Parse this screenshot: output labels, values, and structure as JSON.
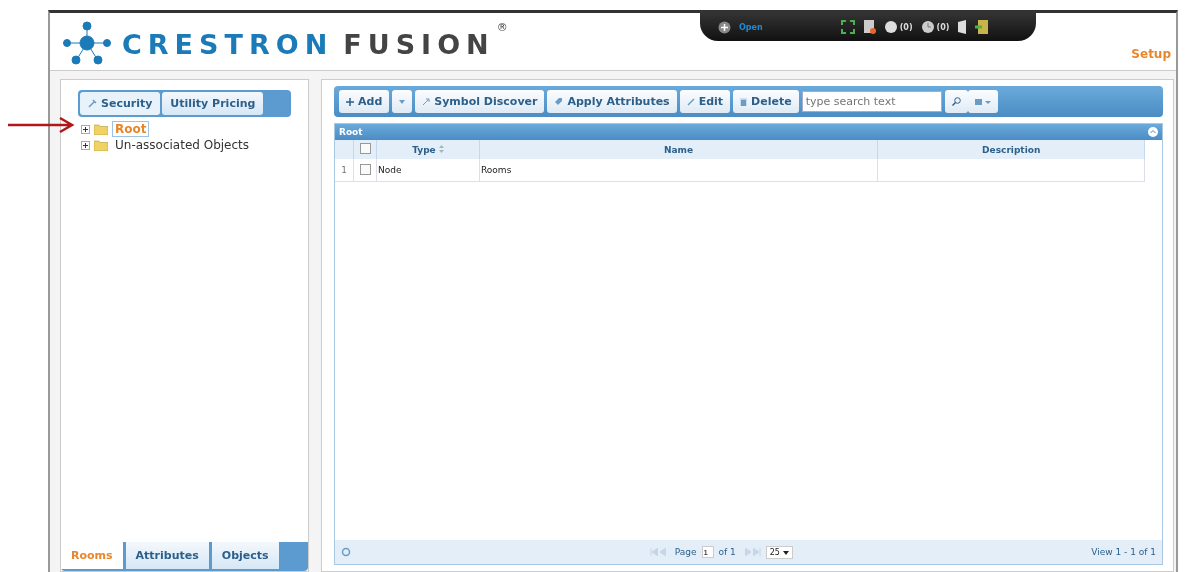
{
  "logo": {
    "brand": "CRESTRON",
    "product": "FUSION",
    "mark": "®"
  },
  "topbar": {
    "open_label": "Open",
    "counters": [
      "(0)",
      "(0)"
    ]
  },
  "setup_link": "Setup",
  "left_tabs": [
    {
      "label": "Security",
      "selected": true
    },
    {
      "label": "Utility Pricing",
      "selected": false
    }
  ],
  "tree": [
    {
      "label": "Root",
      "selected": true,
      "expanded": false
    },
    {
      "label": "Un-associated Objects",
      "selected": false,
      "expanded": false
    }
  ],
  "bottom_tabs": [
    {
      "label": "Rooms",
      "selected": true
    },
    {
      "label": "Attributes",
      "selected": false
    },
    {
      "label": "Objects",
      "selected": false
    }
  ],
  "toolbar": {
    "buttons": [
      {
        "kind": "add",
        "label": "Add"
      },
      {
        "kind": "caret"
      },
      {
        "kind": "discover",
        "label": "Symbol Discover"
      },
      {
        "kind": "apply",
        "label": "Apply Attributes"
      },
      {
        "kind": "edit",
        "label": "Edit"
      },
      {
        "kind": "delete",
        "label": "Delete"
      }
    ],
    "search_placeholder": "type search text"
  },
  "grid": {
    "caption": "Root",
    "all_checked": false,
    "columns": [
      "Type",
      "Name",
      "Description"
    ],
    "rows": [
      {
        "number": "1",
        "checked": false,
        "cells": [
          "Node",
          "Rooms",
          ""
        ]
      }
    ],
    "pager": {
      "page_label": "Page",
      "page": "1",
      "of": "of 1",
      "per_page": "25",
      "view": "View 1 - 1 of 1"
    }
  }
}
